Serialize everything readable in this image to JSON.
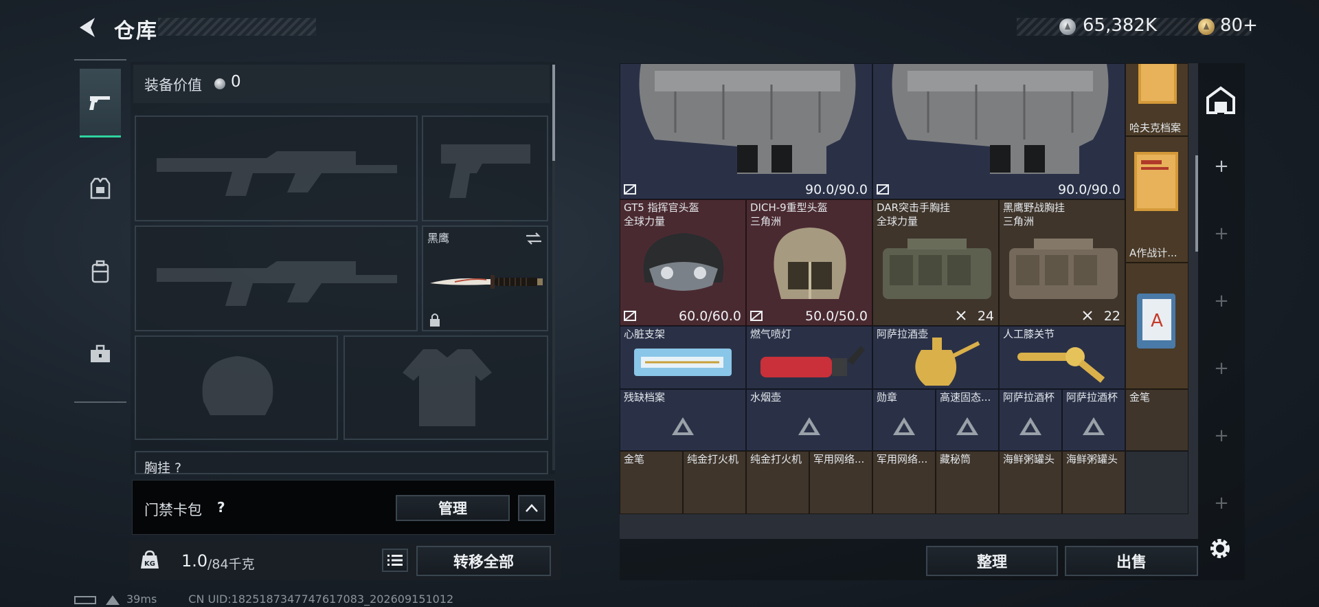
{
  "header": {
    "title": "仓库",
    "silver": "65,382K",
    "gold": "80+"
  },
  "tabs": [
    {
      "icon": "pistol-icon",
      "active": true
    },
    {
      "icon": "armor-icon",
      "active": false
    },
    {
      "icon": "backpack-icon",
      "active": false
    },
    {
      "icon": "toolbox-icon",
      "active": false
    }
  ],
  "equipment": {
    "value_label": "装备价值",
    "value": "0",
    "melee_slot_label": "黑鹰",
    "next_section_label": "胸挂 ?"
  },
  "card_wallet": {
    "label": "门禁卡包",
    "help": "?",
    "manage_label": "管理"
  },
  "weight": {
    "current": "1.0",
    "capacity": "/84千克",
    "kg_badge": "KG"
  },
  "transfer_all_label": "转移全部",
  "stash": {
    "armor_durability_1": "90.0/90.0",
    "armor_durability_2": "90.0/90.0",
    "items": [
      {
        "name": "哈夫克档案"
      },
      {
        "name": "GT5 指挥官头盔",
        "sub": "全球力量",
        "durability": "60.0/60.0"
      },
      {
        "name": "DICH-9重型头盔",
        "sub": "三角洲",
        "durability": "50.0/50.0"
      },
      {
        "name": "DAR突击手胸挂",
        "sub": "全球力量",
        "capacity": "24"
      },
      {
        "name": "黑鹰野战胸挂",
        "sub": "三角洲",
        "capacity": "22"
      },
      {
        "name": "A作战计..."
      },
      {
        "name": "心脏支架"
      },
      {
        "name": "燃气喷灯"
      },
      {
        "name": "阿萨拉酒壶"
      },
      {
        "name": "人工膝关节"
      },
      {
        "name": "残缺档案"
      },
      {
        "name": "水烟壶"
      },
      {
        "name": "勋章"
      },
      {
        "name": "高速固态..."
      },
      {
        "name": "阿萨拉酒杯"
      },
      {
        "name": "阿萨拉酒杯"
      },
      {
        "name": "金笔"
      },
      {
        "name": "金笔"
      },
      {
        "name": "纯金打火机"
      },
      {
        "name": "纯金打火机"
      },
      {
        "name": "军用网络..."
      },
      {
        "name": "军用网络..."
      },
      {
        "name": "藏秘筒"
      },
      {
        "name": "海鲜粥罐头"
      },
      {
        "name": "海鲜粥罐头"
      }
    ]
  },
  "sort_label": "整理",
  "sell_label": "出售",
  "status": {
    "ping": "39ms",
    "uid": "CN UID:1825187347747617083_202609151012"
  },
  "colors": {
    "accent": "#2fd4a0",
    "cell_blue": "#2a3147",
    "cell_red": "#4a2a31",
    "cell_brown": "#3f352b",
    "cell_orange": "#4a3a27"
  }
}
